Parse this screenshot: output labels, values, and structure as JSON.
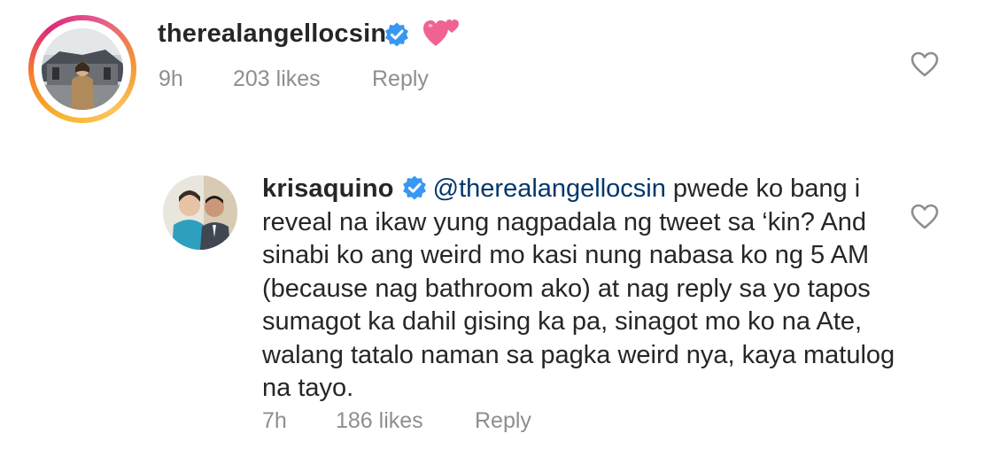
{
  "comments": [
    {
      "username": "therealangellocsin",
      "verified": true,
      "emoji": "two-hearts",
      "time": "9h",
      "likes": "203 likes",
      "reply_label": "Reply",
      "avatar_ring": true
    },
    {
      "username": "krisaquino",
      "verified": true,
      "mention": "@therealangellocsin",
      "text": " pwede ko bang i reveal na ikaw yung nagpadala ng tweet sa ‘kin? And sinabi ko ang weird mo kasi nung nabasa ko ng 5 AM (because nag bathroom ako) at nag reply sa yo tapos sumagot ka dahil gising ka pa, sinagot mo ko na Ate, walang tatalo naman sa pagka weird nya, kaya matulog na tayo.",
      "time": "7h",
      "likes": "186 likes",
      "reply_label": "Reply"
    }
  ],
  "icons": {
    "verified": "verified-badge-icon",
    "like": "heart-outline-icon",
    "emoji": "two-hearts-emoji"
  },
  "colors": {
    "text": "#262626",
    "meta": "#8e8e8e",
    "verified": "#3897f0",
    "mention": "#00376b",
    "emoji": "#f06292"
  }
}
